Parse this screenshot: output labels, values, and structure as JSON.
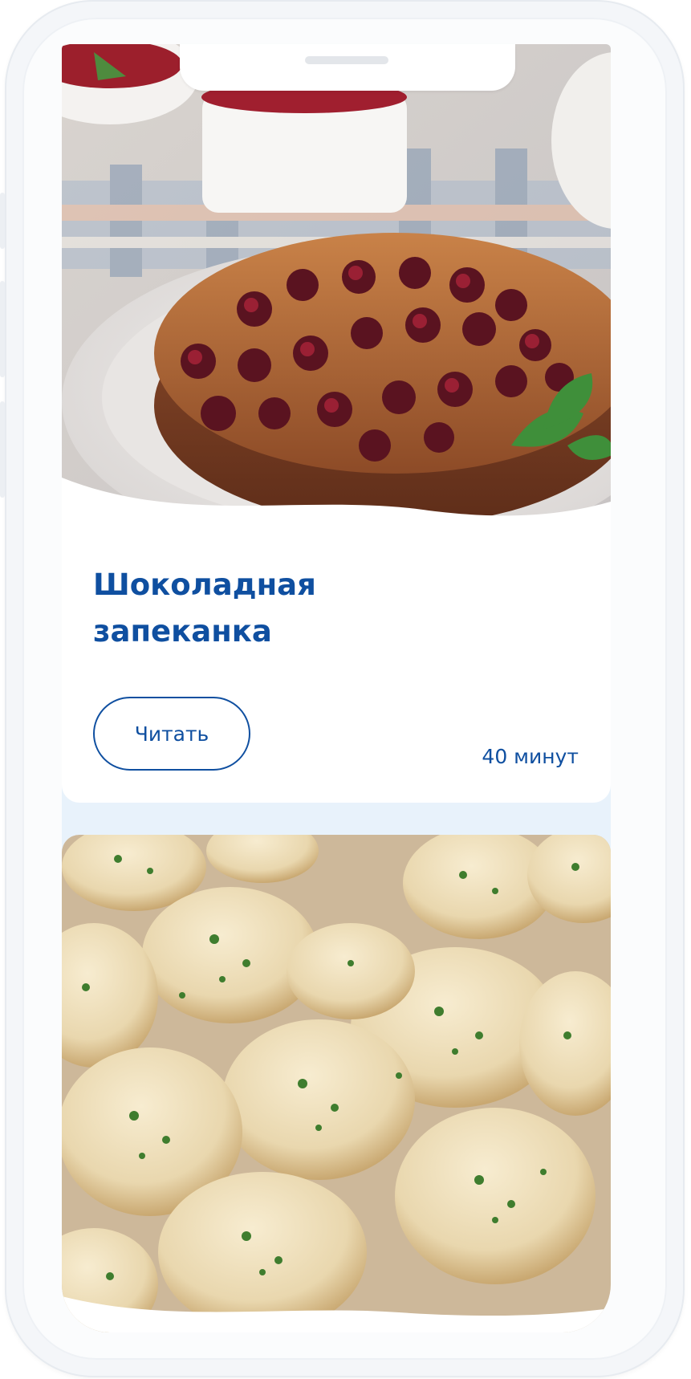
{
  "recipes": [
    {
      "title": "Шоколадная запеканка",
      "image": "berry-casserole-photo",
      "action_label": "Читать",
      "duration": "40 минут"
    },
    {
      "image": "garlic-knots-photo"
    }
  ],
  "colors": {
    "accent": "#0f4fa0",
    "screen_background": "#e8f2fb",
    "card_background": "#ffffff"
  }
}
